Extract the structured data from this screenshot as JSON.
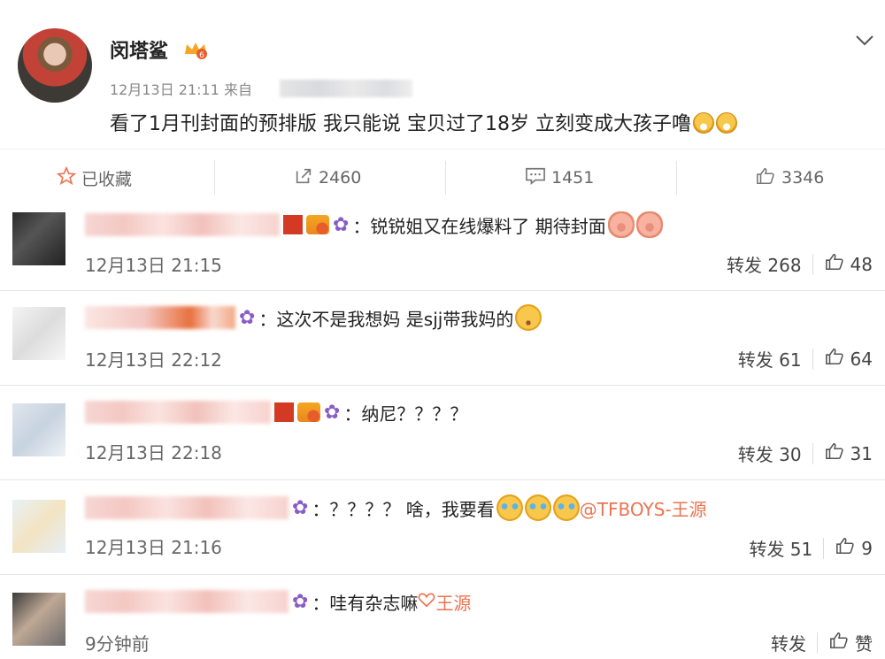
{
  "post": {
    "username": "闵塔鲨",
    "time": "12月13日 21:11",
    "source_prefix": "来自",
    "text": "看了1月刊封面的预排版 我只能说 宝贝过了18岁 立刻变成大孩子噜"
  },
  "actions": {
    "favorite": "已收藏",
    "repost_count": "2460",
    "comment_count": "1451",
    "like_count": "3346"
  },
  "comments": [
    {
      "text": "：锐锐姐又在线爆料了 期待封面",
      "time": "12月13日 21:15",
      "repost": "转发 268",
      "likes": "48"
    },
    {
      "text": "：这次不是我想妈 是sjj带我妈的",
      "time": "12月13日 22:12",
      "repost": "转发 61",
      "likes": "64"
    },
    {
      "text": "：纳尼？？？？",
      "time": "12月13日 22:18",
      "repost": "转发 30",
      "likes": "31"
    },
    {
      "text": "：？？？？ 啥，我要看",
      "mention": "@TFBOYS-王源",
      "time": "12月13日 21:16",
      "repost": "转发 51",
      "likes": "9"
    },
    {
      "text": "：哇有杂志嘛",
      "mention": "王源",
      "time": "9分钟前",
      "repost": "转发",
      "likes": "赞"
    }
  ],
  "colors": {
    "accent": "#eb7350",
    "flower": "#8a5cc7"
  }
}
